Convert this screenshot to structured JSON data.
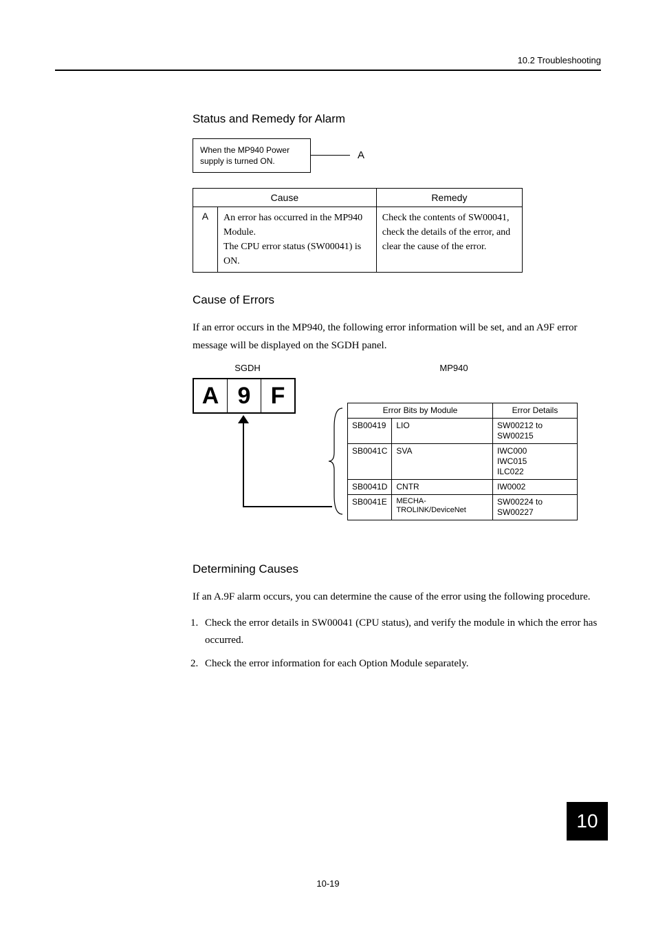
{
  "header": {
    "section": "10.2  Troubleshooting"
  },
  "page_number": "10-19",
  "chapter": "10",
  "status_remedy": {
    "heading": "Status and Remedy for Alarm",
    "box_text_line1": "When the MP940 Power",
    "box_text_line2": "supply is turned ON.",
    "box_label": "A",
    "cause_header": "Cause",
    "remedy_header": "Remedy",
    "row_label": "A",
    "cause_line1": "An error has occurred in the MP940 Module.",
    "cause_line2": "The CPU error status (SW00041) is ON.",
    "remedy_text": "Check the contents of SW00041, check the details of the error, and clear the cause of the error."
  },
  "cause_errors": {
    "heading": "Cause of Errors",
    "intro": "If an error occurs in the MP940, the following error information will be set, and an A9F error message will be displayed on the SGDH panel.",
    "sgdh_label": "SGDH",
    "mp_label": "MP940",
    "display": {
      "c1": "A",
      "c2": "9",
      "c3": "F"
    },
    "table": {
      "h1": "Error Bits by Module",
      "h2": "Error Details",
      "rows": [
        {
          "reg": "SB00419",
          "mod": "LIO",
          "det": "SW00212 to SW00215"
        },
        {
          "reg": "SB0041C",
          "mod": "SVA",
          "det": "IWC000\nIWC015\nILC022"
        },
        {
          "reg": "SB0041D",
          "mod": "CNTR",
          "det": "IW0002"
        },
        {
          "reg": "SB0041E",
          "mod": "MECHA-TROLINK/DeviceNet",
          "det": "SW00224 to SW00227"
        }
      ]
    }
  },
  "determining": {
    "heading": "Determining Causes",
    "intro": "If an A.9F alarm occurs, you can determine the cause of the error using the following procedure.",
    "steps": [
      "Check the error details in SW00041 (CPU status), and verify the module in which the error has occurred.",
      "Check the error information for each Option Module separately."
    ]
  }
}
